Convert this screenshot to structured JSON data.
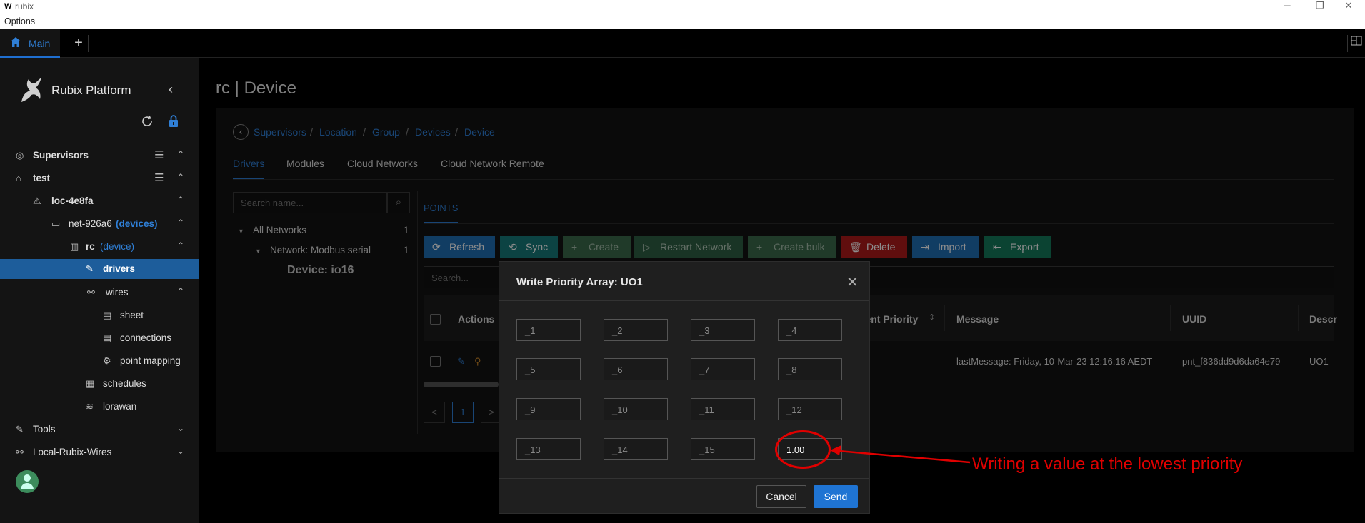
{
  "window": {
    "app_icon": "W",
    "title": "rubix",
    "menu": "Options",
    "controls": {
      "minimize": "─",
      "restore": "❐",
      "close": "✕"
    }
  },
  "app_tabs": {
    "main_label": "Main",
    "add_label": "+",
    "layout_icon": "layout-icon"
  },
  "sidebar": {
    "brand": "Rubix Platform",
    "items": [
      {
        "label": "Supervisors",
        "icon": "supervisors-icon"
      },
      {
        "label": "test",
        "icon": "home-icon"
      },
      {
        "label": "loc-4e8fa",
        "icon": "location-icon"
      },
      {
        "label": "net-926a6",
        "tag": "(devices)",
        "icon": "network-icon"
      },
      {
        "label": "rc",
        "tag": "(device)",
        "icon": "device-icon"
      },
      {
        "label": "drivers",
        "icon": "wrench-icon"
      },
      {
        "label": "wires",
        "icon": "wires-icon"
      },
      {
        "label": "sheet",
        "icon": "sheet-icon"
      },
      {
        "label": "connections",
        "icon": "connections-icon"
      },
      {
        "label": "point mapping",
        "icon": "point-mapping-icon"
      },
      {
        "label": "schedules",
        "icon": "calendar-icon"
      },
      {
        "label": "lorawan",
        "icon": "wifi-icon"
      },
      {
        "label": "Tools",
        "icon": "tools-icon"
      },
      {
        "label": "Local-Rubix-Wires",
        "icon": "wires-local-icon"
      }
    ]
  },
  "main": {
    "title": "rc | Device",
    "breadcrumbs": [
      "Supervisors",
      "Location",
      "Group",
      "Devices",
      "Device"
    ],
    "tabs": [
      "Drivers",
      "Modules",
      "Cloud Networks",
      "Cloud Network Remote"
    ],
    "tree": {
      "search_placeholder": "Search name...",
      "nodes": [
        {
          "label": "All Networks",
          "count": "1"
        },
        {
          "label": "Network: Modbus serial",
          "count": "1"
        }
      ],
      "device": "Device: io16"
    },
    "points": {
      "tab": "POINTS",
      "toolbar": [
        "Refresh",
        "Sync",
        "Create",
        "Restart Network",
        "Create bulk",
        "Delete",
        "Import",
        "Export"
      ],
      "search_placeholder": "Search...",
      "columns": [
        "Actions",
        "rent Priority",
        "Message",
        "UUID",
        "Descr"
      ],
      "row": {
        "message": "lastMessage: Friday, 10-Mar-23 12:16:16 AEDT",
        "uuid": "pnt_f836dd9d6da64e79",
        "description": "UO1"
      },
      "pagination": {
        "prev": "<",
        "current": "1",
        "next": ">"
      }
    }
  },
  "modal": {
    "title": "Write Priority Array: UO1",
    "close": "✕",
    "placeholders": [
      "_1",
      "_2",
      "_3",
      "_4",
      "_5",
      "_6",
      "_7",
      "_8",
      "_9",
      "_10",
      "_11",
      "_12",
      "_13",
      "_14",
      "_15"
    ],
    "slot16_value": "1.00",
    "cancel": "Cancel",
    "send": "Send"
  },
  "annotation": {
    "text": "Writing a value at the lowest priority",
    "color": "#e00000"
  },
  "colors": {
    "accent": "#2f7fd6",
    "active_nav": "#1d5d9b",
    "refresh_btn": "#1f6fb4",
    "sync_btn": "#177a7a",
    "create_btn": "#3b6b4b",
    "restart_btn": "#2f5f44",
    "delete_btn": "#b01b1b",
    "import_btn": "#1f6fb4",
    "export_btn": "#157a5c"
  }
}
